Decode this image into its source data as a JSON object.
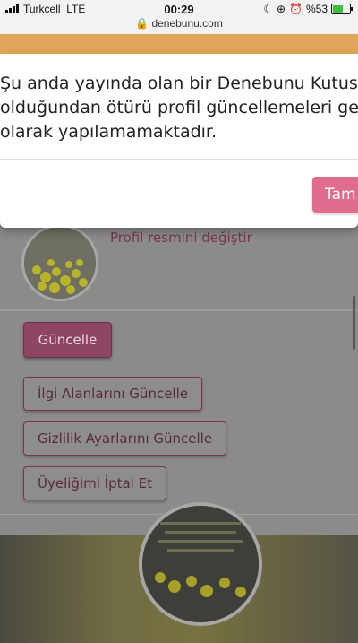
{
  "status_bar": {
    "carrier": "Turkcell",
    "network": "LTE",
    "time": "00:29",
    "url": "denebunu.com",
    "battery": "%53",
    "battery_level": 0.53
  },
  "modal": {
    "message_lines": [
      "Şu anda yayında olan bir Denebunu Kutusu",
      "olduğundan ötürü profil güncellemeleri geçic",
      "olarak yapılamamaktadır."
    ],
    "button_label": "Tam"
  },
  "profile": {
    "change_photo_link": "Profil resmini değiştir"
  },
  "actions": {
    "update_button": "Güncelle",
    "interests_button": "İlgi Alanlarını Güncelle",
    "privacy_button": "Gizlilik Ayarlarını Güncelle",
    "cancel_membership_button": "Üyeliğimi İptal Et"
  },
  "colors": {
    "accent": "#e06d8e",
    "header_orange": "#e2a65a"
  }
}
